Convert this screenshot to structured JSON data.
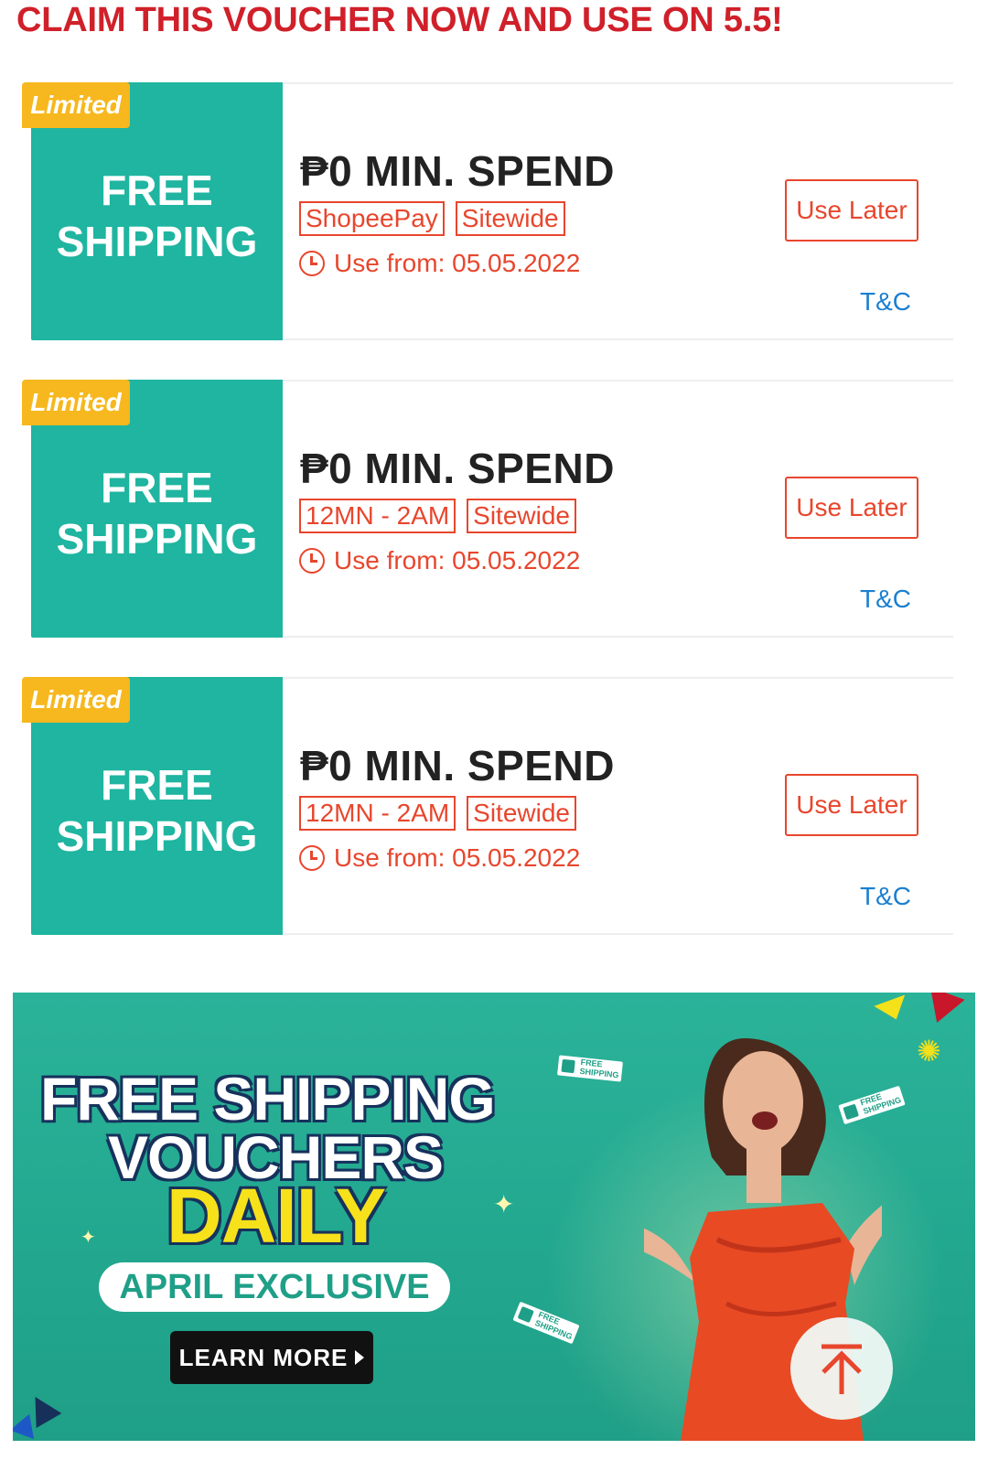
{
  "headline": "CLAIM THIS VOUCHER NOW AND USE ON 5.5!",
  "vouchers": [
    {
      "badge": "Limited",
      "stub_line1": "FREE",
      "stub_line2": "SHIPPING",
      "min_spend": "₱0 MIN. SPEND",
      "tags": [
        "ShopeePay",
        "Sitewide"
      ],
      "use_from": "Use from: 05.05.2022",
      "button": "Use Later",
      "tc": "T&C"
    },
    {
      "badge": "Limited",
      "stub_line1": "FREE",
      "stub_line2": "SHIPPING",
      "min_spend": "₱0 MIN. SPEND",
      "tags": [
        "12MN - 2AM",
        "Sitewide"
      ],
      "use_from": "Use from: 05.05.2022",
      "button": "Use Later",
      "tc": "T&C"
    },
    {
      "badge": "Limited",
      "stub_line1": "FREE",
      "stub_line2": "SHIPPING",
      "min_spend": "₱0 MIN. SPEND",
      "tags": [
        "12MN - 2AM",
        "Sitewide"
      ],
      "use_from": "Use from: 05.05.2022",
      "button": "Use Later",
      "tc": "T&C"
    }
  ],
  "banner": {
    "line1": "FREE SHIPPING",
    "line2": "VOUCHERS",
    "line3": "DAILY",
    "pill": "APRIL EXCLUSIVE",
    "cta": "LEARN MORE",
    "ticket_text": "FREE SHIPPING"
  },
  "colors": {
    "brand_red": "#d0202a",
    "accent_orange": "#e8462d",
    "teal": "#1fb5a0",
    "badge_yellow": "#f6b81e",
    "link_blue": "#1a7fd0"
  },
  "icons": {
    "clock": "clock-icon",
    "scroll_top": "arrow-up-icon",
    "cta_arrow": "play-triangle-icon"
  }
}
